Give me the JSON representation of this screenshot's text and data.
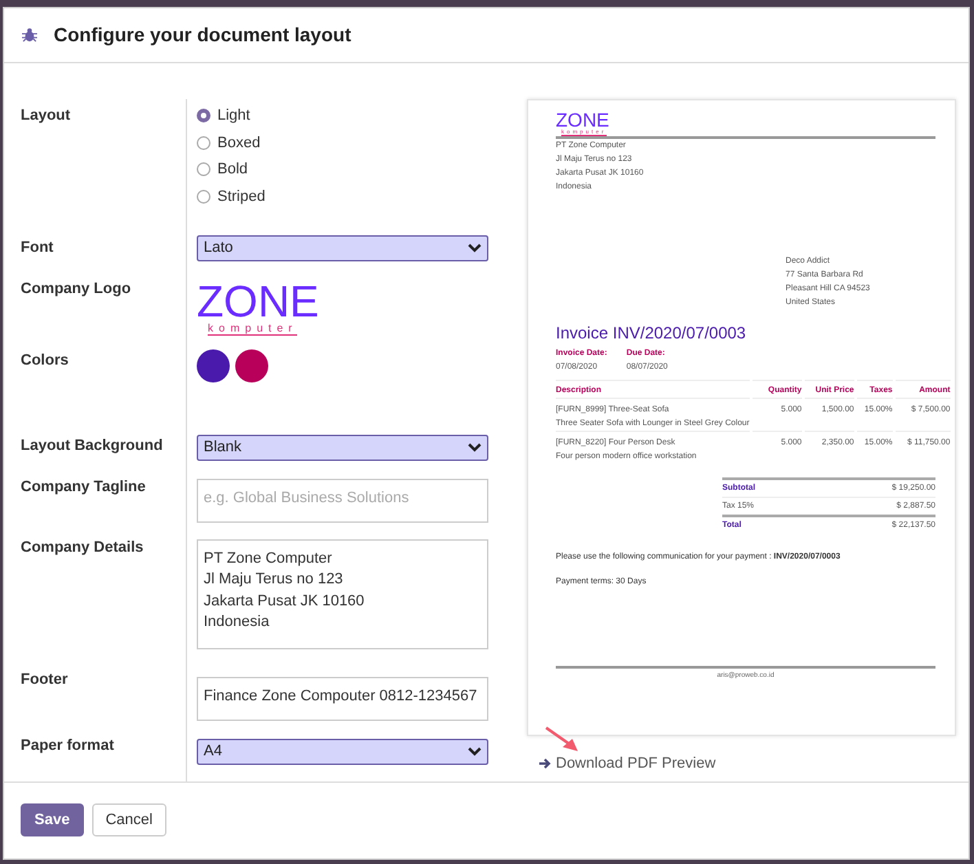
{
  "dialog": {
    "title": "Configure your document layout"
  },
  "form": {
    "layout": {
      "label": "Layout",
      "options": [
        {
          "label": "Light",
          "selected": true
        },
        {
          "label": "Boxed",
          "selected": false
        },
        {
          "label": "Bold",
          "selected": false
        },
        {
          "label": "Striped",
          "selected": false
        }
      ]
    },
    "font": {
      "label": "Font",
      "value": "Lato"
    },
    "company_logo": {
      "label": "Company Logo",
      "wordmark": "ZONE",
      "subtitle": "komputer"
    },
    "colors": {
      "label": "Colors",
      "swatches": [
        {
          "color": "#4a1aad"
        },
        {
          "color": "#b8005a"
        }
      ]
    },
    "layout_background": {
      "label": "Layout Background",
      "value": "Blank"
    },
    "company_tagline": {
      "label": "Company Tagline",
      "placeholder": "e.g. Global Business Solutions"
    },
    "company_details": {
      "label": "Company Details",
      "lines": [
        "PT Zone Computer",
        "Jl Maju Terus no 123",
        "Jakarta Pusat JK 10160",
        "Indonesia"
      ]
    },
    "footer": {
      "label": "Footer",
      "value": "Finance Zone Compouter 0812-1234567"
    },
    "paper_format": {
      "label": "Paper format",
      "value": "A4"
    }
  },
  "preview": {
    "logo": {
      "wordmark": "ZONE",
      "subtitle": "komputer"
    },
    "company_lines": [
      "PT Zone Computer",
      "Jl Maju Terus no 123",
      "Jakarta Pusat JK 10160",
      "Indonesia"
    ],
    "customer_lines": [
      "Deco Addict",
      "77 Santa Barbara Rd",
      "Pleasant Hill CA 94523",
      "United States"
    ],
    "title": "Invoice INV/2020/07/0003",
    "info": [
      {
        "label": "Invoice Date:",
        "value": "07/08/2020"
      },
      {
        "label": "Due Date:",
        "value": "08/07/2020"
      }
    ],
    "columns": [
      "Description",
      "Quantity",
      "Unit Price",
      "Taxes",
      "Amount"
    ],
    "rows": [
      {
        "description": "[FURN_8999] Three-Seat Sofa",
        "note": "Three Seater Sofa with Lounger in Steel Grey Colour",
        "quantity": "5.000",
        "unit_price": "1,500.00",
        "taxes": "15.00%",
        "amount": "$ 7,500.00"
      },
      {
        "description": "[FURN_8220] Four Person Desk",
        "note": "Four person modern office workstation",
        "quantity": "5.000",
        "unit_price": "2,350.00",
        "taxes": "15.00%",
        "amount": "$ 11,750.00"
      }
    ],
    "totals": [
      {
        "label": "Subtotal",
        "value": "$ 19,250.00",
        "kind": "strong"
      },
      {
        "label": "Tax 15%",
        "value": "$ 2,887.50",
        "kind": "plain"
      },
      {
        "label": "Total",
        "value": "$ 22,137.50",
        "kind": "strong"
      }
    ],
    "communication": "Please use the following communication for your payment : **INV/2020/07/0003**",
    "payment_terms": "Payment terms: 30 Days",
    "footer_text": "aris@proweb.co.id"
  },
  "download_link": "Download PDF Preview",
  "buttons": [
    {
      "label": "Save",
      "kind": "primary"
    },
    {
      "label": "Cancel",
      "kind": "secondary"
    }
  ]
}
